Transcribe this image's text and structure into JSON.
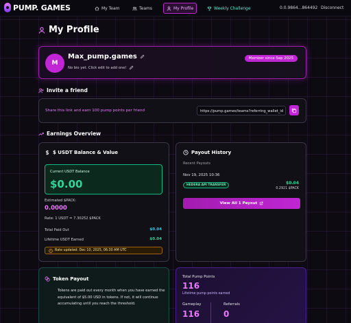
{
  "nav": {
    "logo": "PUMP. GAMES",
    "items": [
      {
        "label": "My Team",
        "icon": "home-icon"
      },
      {
        "label": "Teams",
        "icon": "users-icon"
      },
      {
        "label": "My Profile",
        "icon": "user-icon",
        "active": true
      },
      {
        "label": "Weekly Challenge",
        "icon": "trophy-icon"
      }
    ],
    "wallet": "0.0.9864...864492",
    "disconnect": "Disconnect"
  },
  "page": {
    "title": "My Profile"
  },
  "profile": {
    "avatar_letter": "M",
    "name": "Max_pump.games",
    "bio": "No bio yet. Click edit to add one!",
    "member_badge": "Member since Sep 2025"
  },
  "invite": {
    "title": "Invite a friend",
    "text": "Share this link and earn 100 pump points per friend",
    "link": "https://pump.games/teams?referring_wallet_id"
  },
  "earnings": {
    "title": "Earnings Overview",
    "balance_card": {
      "title": "$ USDT Balance & Value",
      "current_label": "Current USDT Balance",
      "current_value": "$0.00",
      "estimated_label": "Estimated $PACK:",
      "estimated_value": "0.0000",
      "rate": "Rate: 1 USDT = 7.30252 $PACK",
      "total_paid_label": "Total Paid Out",
      "total_paid_value": "$0.04",
      "lifetime_label": "Lifetime USDT Earned",
      "lifetime_value": "$0.04",
      "rate_updated": "Rate updated: Dec 10, 2025, 06:30 AM UTC"
    },
    "payout_card": {
      "title": "Payout History",
      "recent_label": "Recent Payouts",
      "date": "Nov 19, 2025 10:36",
      "badge": "HEDERA API TRANSFER",
      "amount": "$0.04",
      "pack": "0.2921 $PACK",
      "view_all": "View All 1 Payout"
    }
  },
  "token_payout": {
    "title": "Token Payout",
    "text": "Tokens are paid out every month when you have earned the equivalent of $5.00 USD in tokens. If not, it will continue accumulating until you reach the threshold."
  },
  "points": {
    "title": "Total Pump Points",
    "total": "116",
    "lifetime_label": "Lifetime pump points earned",
    "gameplay_label": "Gameplay",
    "gameplay_value": "116",
    "referrals_label": "Referrals",
    "referrals_value": "0"
  },
  "colors": {
    "accent": "#c026d3",
    "green": "#34d399",
    "teal": "#5eead4",
    "background": "#0d0a12"
  }
}
